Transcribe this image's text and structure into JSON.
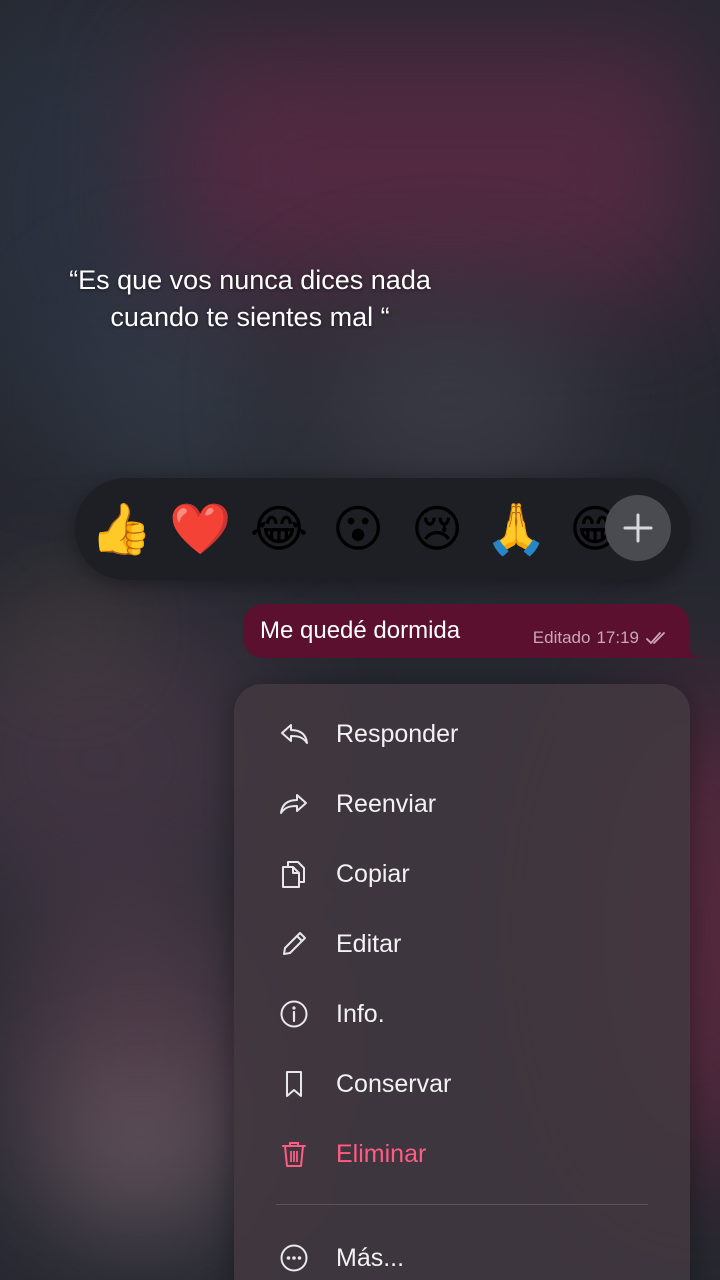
{
  "caption": {
    "line1": "“Es que vos nunca dices nada",
    "line2": "cuando te sientes mal “"
  },
  "reactions": {
    "items": [
      {
        "name": "thumbs-up-emoji",
        "glyph": "👍"
      },
      {
        "name": "red-heart-emoji",
        "glyph": "❤️"
      },
      {
        "name": "tears-of-joy-emoji",
        "glyph": "😂"
      },
      {
        "name": "surprised-emoji",
        "glyph": "😮"
      },
      {
        "name": "crying-emoji",
        "glyph": "😢"
      },
      {
        "name": "folded-hands-emoji",
        "glyph": "🙏"
      },
      {
        "name": "grinning-emoji",
        "glyph": "😁"
      }
    ],
    "more_icon": "plus-icon"
  },
  "message": {
    "text": "Me quedé dormida",
    "edited_label": "Editado",
    "time": "17:19",
    "status_icon": "double-check-icon",
    "bubble_color": "#5c1030"
  },
  "menu": {
    "items": [
      {
        "label": "Responder",
        "icon": "reply-icon"
      },
      {
        "label": "Reenviar",
        "icon": "forward-icon"
      },
      {
        "label": "Copiar",
        "icon": "copy-icon"
      },
      {
        "label": "Editar",
        "icon": "pencil-icon"
      },
      {
        "label": "Info.",
        "icon": "info-icon"
      },
      {
        "label": "Conservar",
        "icon": "bookmark-icon"
      },
      {
        "label": "Eliminar",
        "icon": "trash-icon",
        "danger_color": "#ff5c84"
      },
      {
        "label": "Más...",
        "icon": "more-icon"
      }
    ]
  }
}
